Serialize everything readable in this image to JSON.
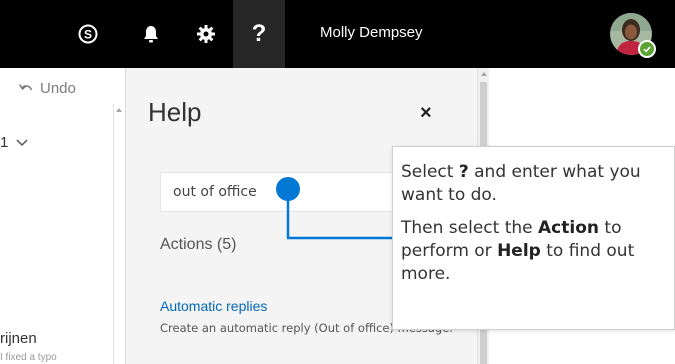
{
  "header": {
    "user_name": "Molly Dempsey",
    "help_glyph": "?",
    "icons": [
      "skype-icon",
      "bell-icon",
      "gear-icon",
      "help-icon",
      "avatar"
    ]
  },
  "left": {
    "undo_label": "Undo",
    "count_fragment": "1",
    "name_fragment": "rijnen",
    "sub_fragment": "I fixed a typo"
  },
  "help_panel": {
    "title": "Help",
    "close_glyph": "×",
    "search_value": "out of office",
    "actions_heading": "Actions (5)",
    "result_title": "Automatic replies",
    "result_description": "Create an automatic reply (Out of office) message."
  },
  "callout": {
    "line1_pre": "Select",
    "line1_bold": "?",
    "line1_post": "and enter what you want to do.",
    "line2_pre": "Then select the",
    "line2_bold1": "Action",
    "line2_mid": "to perform or",
    "line2_bold2": "Help",
    "line2_post": "to find out more."
  },
  "colors": {
    "topbar": "#000000",
    "accent_blue": "#0078d4",
    "link_blue": "#0067b8",
    "presence_green": "#5ba332"
  }
}
